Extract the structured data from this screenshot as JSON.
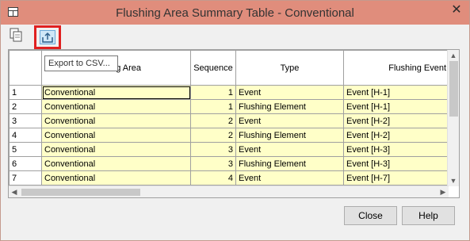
{
  "window": {
    "title": "Flushing Area Summary Table - Conventional"
  },
  "tooltip": {
    "text": "Export to CSV..."
  },
  "icons": {
    "app": "grid-app-icon",
    "copy": "copy-icon",
    "export": "export-icon",
    "close": "close-icon"
  },
  "table": {
    "columns": [
      "",
      "Flushing Area",
      "Sequence",
      "Type",
      "Flushing Event"
    ],
    "rows": [
      [
        "1",
        "Conventional",
        "1",
        "Event",
        "Event [H-1]"
      ],
      [
        "2",
        "Conventional",
        "1",
        "Flushing Element",
        "Event [H-1]"
      ],
      [
        "3",
        "Conventional",
        "2",
        "Event",
        "Event [H-2]"
      ],
      [
        "4",
        "Conventional",
        "2",
        "Flushing Element",
        "Event [H-2]"
      ],
      [
        "5",
        "Conventional",
        "3",
        "Event",
        "Event [H-3]"
      ],
      [
        "6",
        "Conventional",
        "3",
        "Flushing Element",
        "Event [H-3]"
      ],
      [
        "7",
        "Conventional",
        "4",
        "Event",
        "Event [H-7]"
      ]
    ]
  },
  "buttons": {
    "close": "Close",
    "help": "Help"
  },
  "colors": {
    "titlebar": "#e08d7c",
    "cell_fill": "#ffffc8",
    "highlight": "#e02020"
  }
}
